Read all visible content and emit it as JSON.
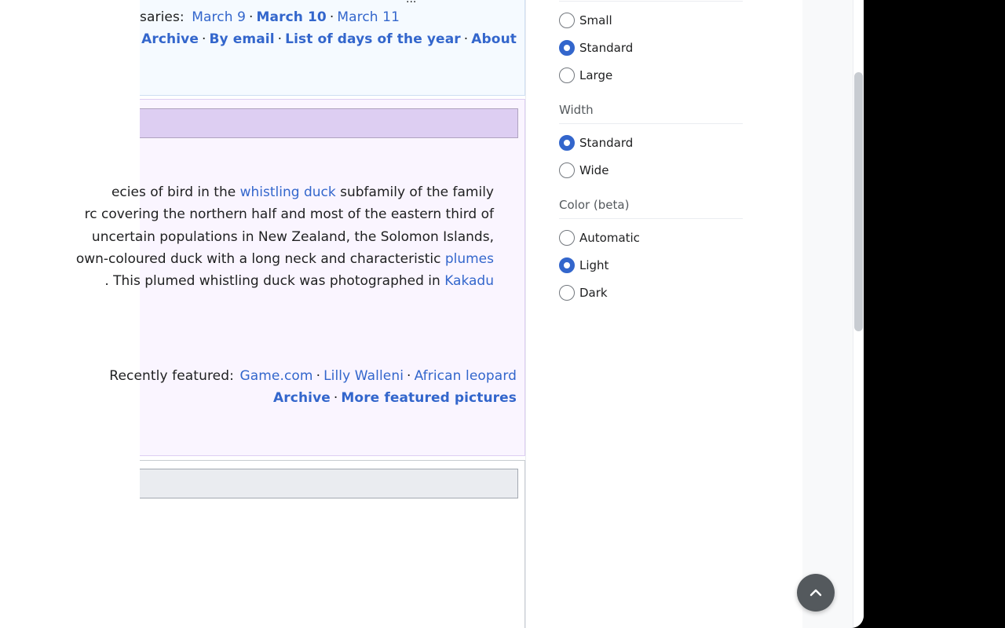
{
  "otd": {
    "anniversaries_prefix": "saries:",
    "days": [
      "March 9",
      "March 10",
      "March 11"
    ],
    "links": [
      "Archive",
      "By email",
      "List of days of the year",
      "About"
    ]
  },
  "potd": {
    "lines": [
      [
        {
          "t": "ecies of bird in the "
        },
        {
          "t": "whistling duck",
          "link": true
        },
        {
          "t": " subfamily of the family"
        }
      ],
      [
        {
          "t": "rc covering the northern half and most of the eastern third of"
        }
      ],
      [
        {
          "t": " uncertain populations in New Zealand, the Solomon Islands,"
        }
      ],
      [
        {
          "t": "own-coloured duck with a long neck and characteristic "
        },
        {
          "t": "plumes",
          "link": true
        }
      ],
      [
        {
          "t": ". This plumed whistling duck was photographed in "
        },
        {
          "t": "Kakadu",
          "link": true
        }
      ]
    ],
    "recently_featured_label": "Recently featured:",
    "recently_featured": [
      "Game.com",
      "Lilly Walleni",
      "African leopard"
    ],
    "bottom_links": [
      "Archive",
      "More featured pictures"
    ]
  },
  "appearance": {
    "text_options": [
      {
        "label": "Small",
        "checked": false
      },
      {
        "label": "Standard",
        "checked": true
      },
      {
        "label": "Large",
        "checked": false
      }
    ],
    "width_title": "Width",
    "width_options": [
      {
        "label": "Standard",
        "checked": true
      },
      {
        "label": "Wide",
        "checked": false
      }
    ],
    "color_title": "Color (beta)",
    "color_options": [
      {
        "label": "Automatic",
        "checked": false
      },
      {
        "label": "Light",
        "checked": true
      },
      {
        "label": "Dark",
        "checked": false
      }
    ]
  },
  "icons": {
    "scroll_top": "chevron-up-icon"
  },
  "colors": {
    "link": "#3366cc",
    "potd_bg": "#faf5ff",
    "potd_heading": "#ddcef2",
    "otd_bg": "#f5faff",
    "accent": "#3366cc"
  }
}
